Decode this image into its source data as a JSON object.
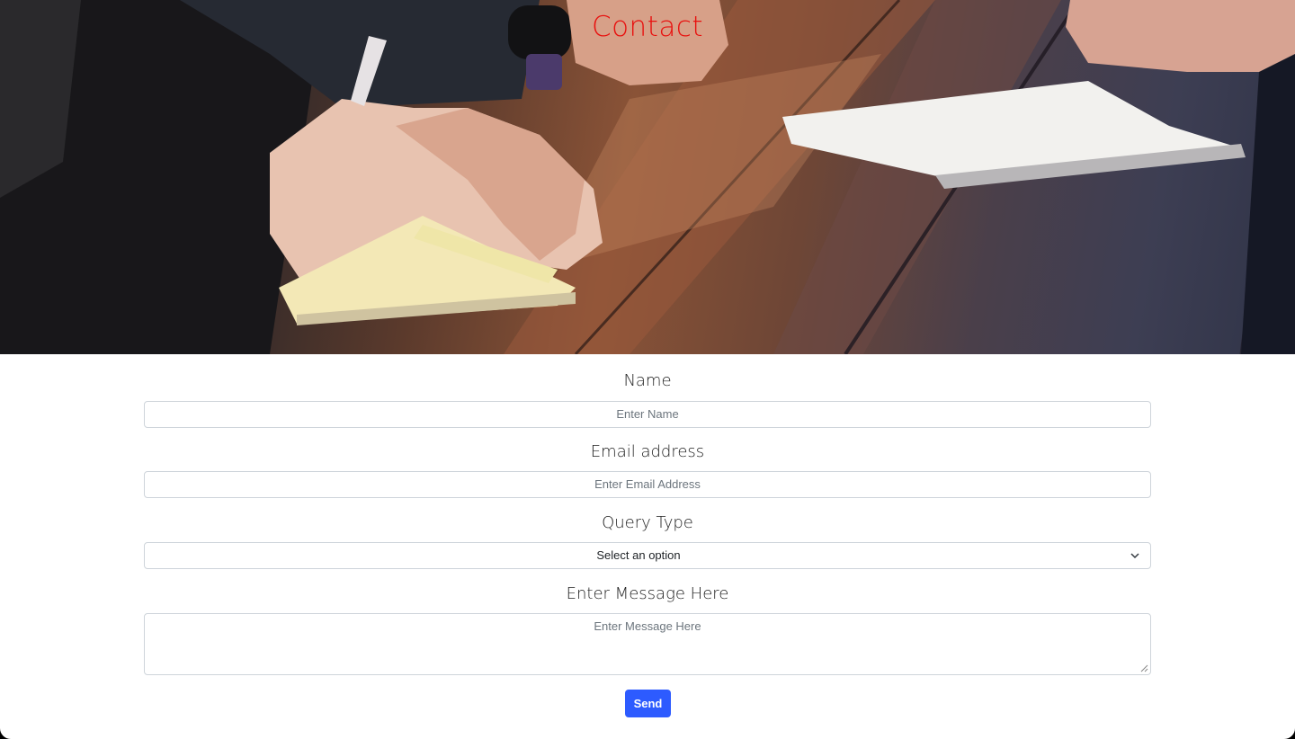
{
  "hero": {
    "title": "Contact",
    "image_description_icon": "photo-hands-writing-notebook"
  },
  "form": {
    "name_label": "Name",
    "name_placeholder": "Enter Name",
    "email_label": "Email address",
    "email_placeholder": "Enter Email Address",
    "query_label": "Query Type",
    "query_selected": "Select an option",
    "message_label": "Enter Message Here",
    "message_placeholder": "Enter Message Here",
    "send_label": "Send"
  },
  "colors": {
    "title": "#e8110f",
    "button": "#2d5bff"
  }
}
